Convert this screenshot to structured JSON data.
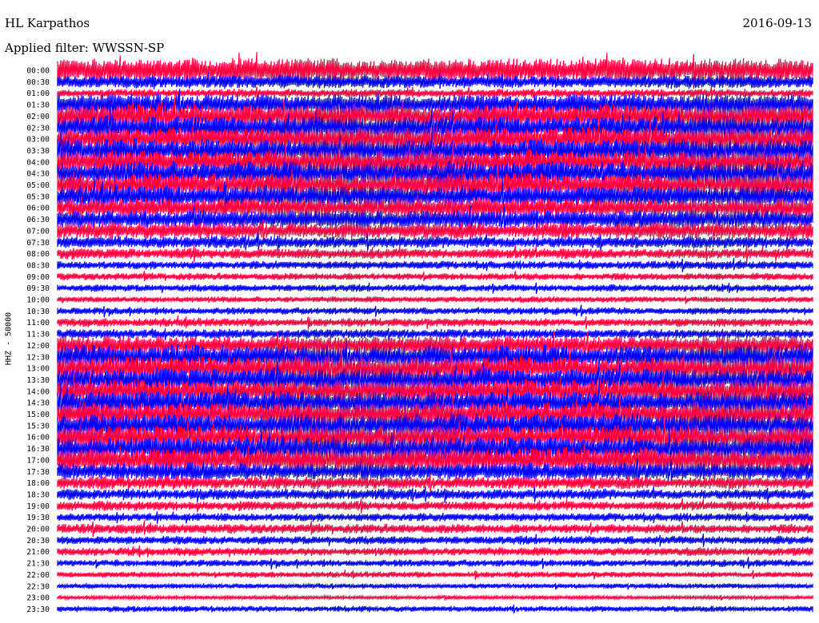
{
  "chart_data": {
    "type": "line",
    "title": "HL Karpathos",
    "date": "2016-09-13",
    "filter": "Applied filter: WWSSN-SP",
    "ylabel": "HHZ - 50000",
    "tick_labels": [
      "00:00",
      "00:30",
      "01:00",
      "01:30",
      "02:00",
      "02:30",
      "03:00",
      "03:30",
      "04:00",
      "04:30",
      "05:00",
      "05:30",
      "06:00",
      "06:30",
      "07:00",
      "07:30",
      "08:00",
      "08:30",
      "09:00",
      "09:30",
      "10:00",
      "10:30",
      "11:00",
      "11:30",
      "12:00",
      "12:30",
      "13:00",
      "13:30",
      "14:00",
      "14:30",
      "15:00",
      "15:30",
      "16:00",
      "16:30",
      "17:00",
      "17:30",
      "18:00",
      "18:30",
      "19:00",
      "19:30",
      "20:00",
      "20:30",
      "21:00",
      "21:30",
      "22:00",
      "22:30",
      "23:00",
      "23:30"
    ],
    "trace_colors": [
      "#ff0040",
      "#0000ff"
    ],
    "trace_amplitudes": [
      1.0,
      0.55,
      0.35,
      0.9,
      1.0,
      1.0,
      1.0,
      1.0,
      1.0,
      1.0,
      1.0,
      0.9,
      0.8,
      0.8,
      0.7,
      0.5,
      0.45,
      0.35,
      0.3,
      0.3,
      0.25,
      0.3,
      0.35,
      0.4,
      0.8,
      1.0,
      1.0,
      1.0,
      1.0,
      1.0,
      1.0,
      1.0,
      1.0,
      1.0,
      1.0,
      0.75,
      0.55,
      0.45,
      0.4,
      0.35,
      0.4,
      0.35,
      0.35,
      0.3,
      0.25,
      0.2,
      0.15,
      0.25
    ],
    "grid": false,
    "legend": "none"
  }
}
